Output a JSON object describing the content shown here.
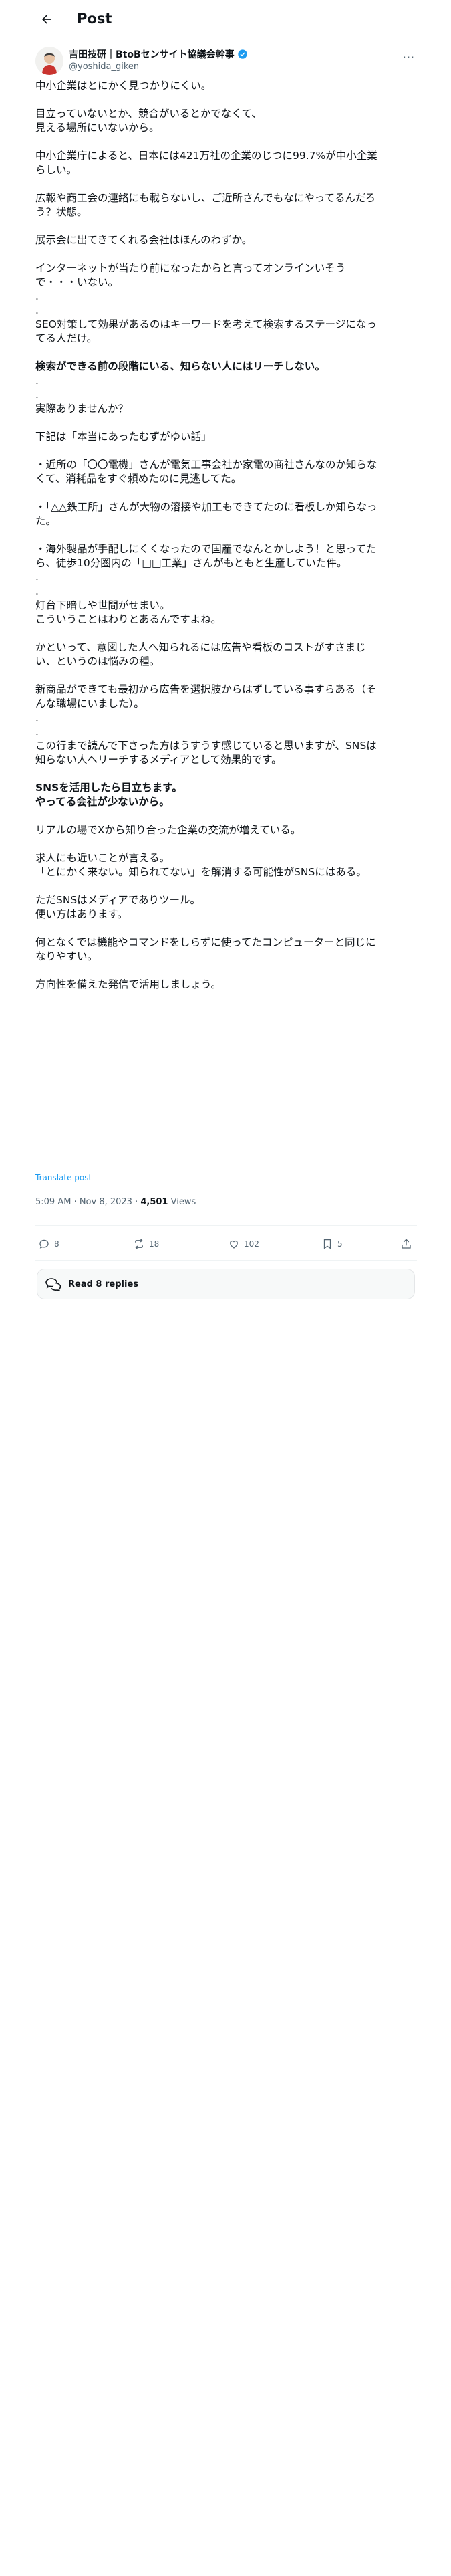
{
  "topbar": {
    "title": "Post"
  },
  "author": {
    "name": "吉田技研｜BtoBセンサイト協議会幹事",
    "handle": "@yoshida_giken",
    "more_label": "···"
  },
  "post": {
    "lines": [
      {
        "text": "中小企業はとにかく見つかりにくい。"
      },
      {
        "text": ""
      },
      {
        "text": "目立っていないとか、競合がいるとかでなくて、"
      },
      {
        "text": "見える場所にいないから。"
      },
      {
        "text": ""
      },
      {
        "text": "中小企業庁によると、日本には421万社の企業のじつに99.7%が中小企業"
      },
      {
        "text": "らしい。"
      },
      {
        "text": ""
      },
      {
        "text": "広報や商工会の連絡にも載らないし、ご近所さんでもなにやってるんだろ"
      },
      {
        "text": "う？状態。"
      },
      {
        "text": ""
      },
      {
        "text": "展示会に出てきてくれる会社はほんのわずか。"
      },
      {
        "text": ""
      },
      {
        "text": "インターネットが当たり前になったからと言ってオンラインいそう"
      },
      {
        "text": "で・・・いない。"
      },
      {
        "text": "."
      },
      {
        "text": "."
      },
      {
        "text": "SEO対策して効果があるのはキーワードを考えて検索するステージになっ"
      },
      {
        "text": "てる人だけ。"
      },
      {
        "text": ""
      },
      {
        "text": "検索ができる前の段階にいる、知らない人にはリーチしない。",
        "bold": true
      },
      {
        "text": "."
      },
      {
        "text": "."
      },
      {
        "text": "実際ありませんか？"
      },
      {
        "text": ""
      },
      {
        "text": "下記は「本当にあったむずがゆい話」"
      },
      {
        "text": ""
      },
      {
        "text": "・近所の「〇〇電機」さんが電気工事会社か家電の商社さんなのか知らな"
      },
      {
        "text": "くて、消耗品をすぐ頼めたのに見逃してた。"
      },
      {
        "text": ""
      },
      {
        "text": "・「△△鉄工所」さんが大物の溶接や加工もできてたのに看板しか知らなっ"
      },
      {
        "text": "た。"
      },
      {
        "text": ""
      },
      {
        "text": "・海外製品が手配しにくくなったので国産でなんとかしよう！と思ってた"
      },
      {
        "text": "ら、徒歩10分圏内の「□□工業」さんがもともと生産していた件。"
      },
      {
        "text": "."
      },
      {
        "text": "."
      },
      {
        "text": "灯台下暗しや世間がせまい。"
      },
      {
        "text": "こういうことはわりとあるんですよね。"
      },
      {
        "text": ""
      },
      {
        "text": "かといって、意図した人へ知られるには広告や看板のコストがすさまじ"
      },
      {
        "text": "い、というのは悩みの種。"
      },
      {
        "text": ""
      },
      {
        "text": "新商品ができても最初から広告を選択肢からはずしている事すらある（そ"
      },
      {
        "text": "んな職場にいました）。"
      },
      {
        "text": "."
      },
      {
        "text": "."
      },
      {
        "text": "この行まで読んで下さった方はうすうす感じていると思いますが、SNSは"
      },
      {
        "text": "知らない人へリーチするメディアとして効果的です。"
      },
      {
        "text": ""
      },
      {
        "text": "SNSを活用したら目立ちます。",
        "bold": true
      },
      {
        "text": "やってる会社が少ないから。",
        "bold": true
      },
      {
        "text": ""
      },
      {
        "text": "リアルの場でXから知り合った企業の交流が増えている。"
      },
      {
        "text": ""
      },
      {
        "text": "求人にも近いことが言える。"
      },
      {
        "text": "「とにかく来ない。知られてない」を解消する可能性がSNSにはある。"
      },
      {
        "text": ""
      },
      {
        "text": "ただSNSはメディアでありツール。"
      },
      {
        "text": "使い方はあります。"
      },
      {
        "text": ""
      },
      {
        "text": "何となくでは機能やコマンドをしらずに使ってたコンピューターと同じに"
      },
      {
        "text": "なりやすい。"
      },
      {
        "text": ""
      },
      {
        "text": "方向性を備えた発信で活用しましょう。"
      }
    ],
    "translate_label": "Translate post",
    "timestamp": "5:09 AM · Nov 8, 2023 · ",
    "views_count": "4,501",
    "views_label": " Views"
  },
  "actions": {
    "replies": "8",
    "reposts": "18",
    "likes": "102",
    "bookmarks": "5"
  },
  "read_replies_label": "Read 8 replies",
  "colors": {
    "accent": "#1d9bf0",
    "secondary_text": "#536471",
    "border": "#eff3f4"
  }
}
